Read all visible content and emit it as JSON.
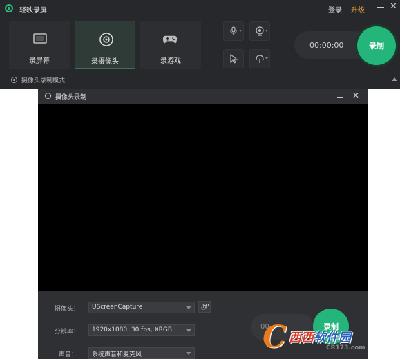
{
  "app": {
    "title": "轻映录屏",
    "login_label": "登录",
    "upgrade_label": "升级",
    "close_glyph": "✕"
  },
  "modes": [
    {
      "label": "录屏幕",
      "icon": "monitor-icon"
    },
    {
      "label": "录摄像头",
      "icon": "webcam-icon",
      "active": true
    },
    {
      "label": "录游戏",
      "icon": "gamepad-icon"
    }
  ],
  "toolbar": {
    "mic_icon": "microphone-icon",
    "webcam_icon": "webcam-toggle-icon",
    "cursor_icon": "cursor-icon",
    "audio_icon": "audio-output-icon"
  },
  "timer": "00:00:00",
  "record_label": "录制",
  "mode_status": "摄像头录制模式",
  "camera_window": {
    "title": "摄像头录制",
    "close_glyph": "✕",
    "fields": [
      {
        "label": "摄像头：",
        "value": "UScreenCapture"
      },
      {
        "label": "分辨率：",
        "value": "1920x1080, 30 fps, XRGB"
      },
      {
        "label": "声音：",
        "value": "系统声音和麦克风"
      }
    ],
    "timer_partial": "00",
    "record_label": "录制"
  },
  "watermark": {
    "logo_letter": "C",
    "name_part1": "西西",
    "name_part2": "软件园",
    "url": "CR173.com"
  },
  "colors": {
    "accent": "#24b57a",
    "upgrade": "#e8a33c",
    "bg_dark": "#26282b"
  }
}
